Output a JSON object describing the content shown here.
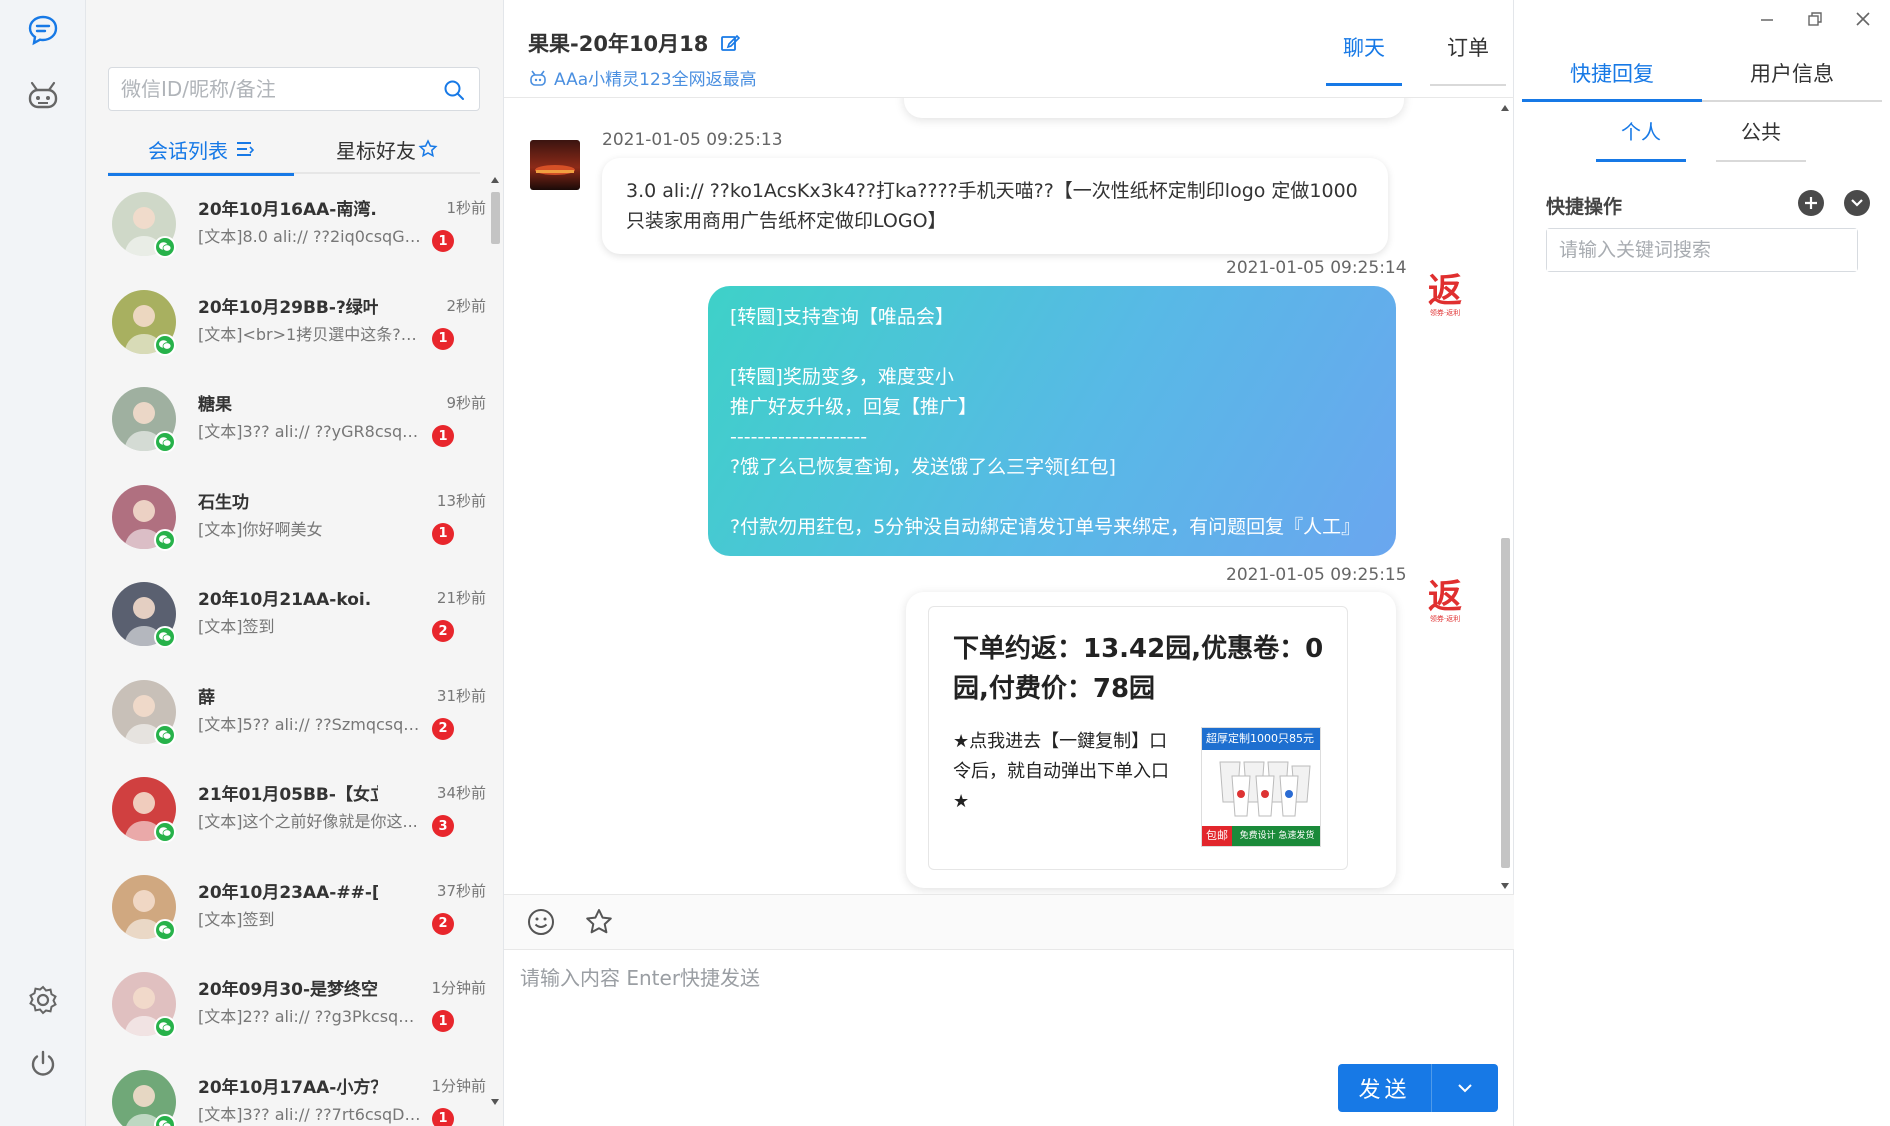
{
  "nav": {
    "icons": [
      "chat-icon",
      "robot-icon",
      "settings-icon",
      "power-icon"
    ]
  },
  "search": {
    "placeholder": "微信ID/昵称/备注"
  },
  "list_tabs": {
    "sessions": "会话列表",
    "starred": "星标好友"
  },
  "conversations": [
    {
      "name": "20年10月16AA-南湾...",
      "time": "1秒前",
      "msg": "[文本]8.0 ali:// ??2iq0csqGW...",
      "unread": "1",
      "avatar_color": "#cfd8c8"
    },
    {
      "name": "20年10月29BB-?绿叶...",
      "time": "2秒前",
      "msg": "[文本]<br>1拷贝選中这条??...",
      "unread": "1",
      "avatar_color": "#a8b060"
    },
    {
      "name": "糖果",
      "time": "9秒前",
      "msg": "[文本]3?? ali:// ??yGR8csqDT...",
      "unread": "1",
      "avatar_color": "#9fb0a0"
    },
    {
      "name": "石生功",
      "time": "13秒前",
      "msg": "[文本]你好啊美女",
      "unread": "1",
      "avatar_color": "#b07080"
    },
    {
      "name": "20年10月21AA-koi.",
      "time": "21秒前",
      "msg": "[文本]签到",
      "unread": "2",
      "avatar_color": "#5a6070"
    },
    {
      "name": "薛",
      "time": "31秒前",
      "msg": "[文本]5?? ali:// ??SzmqcsqD...",
      "unread": "2",
      "avatar_color": "#c8c0b8"
    },
    {
      "name": "21年01月05BB-【女立...",
      "time": "34秒前",
      "msg": "[文本]这个之前好像就是你这...",
      "unread": "3",
      "avatar_color": "#d04040"
    },
    {
      "name": "20年10月23AA-##-[A...",
      "time": "37秒前",
      "msg": "[文本]签到",
      "unread": "2",
      "avatar_color": "#d0a880"
    },
    {
      "name": "20年09月30-是梦终空≡°",
      "time": "1分钟前",
      "msg": "[文本]2?? ali:// ??g3PkcsqDh...",
      "unread": "1",
      "avatar_color": "#e0c0c0"
    },
    {
      "name": "20年10月17AA-小方？",
      "time": "1分钟前",
      "msg": "[文本]3?? ali:// ??7rt6csqDh...",
      "unread": "1",
      "avatar_color": "#70a878"
    }
  ],
  "chat": {
    "title": "果果-20年10月18",
    "subtitle": "AAa小精灵123全网返最高",
    "tabs": {
      "chat": "聊天",
      "order": "订单"
    },
    "messages": {
      "m1_time": "2021-01-05 09:25:13",
      "m1_text": "3.0 ali:// ??ko1AcsKx3k4??打ka????手机天喵??【一次性纸杯定制印logo 定做1000只装家用商用广告纸杯定做印LOGO】",
      "m2_time": "2021-01-05 09:25:14",
      "m2_text": "[转圜]支持查询【唯品会】\n\n[转圜]奖励变多，难度变小\n推广好友升级，回复【推广】\n--------------------\n?饿了么已恢复查询，发送饿了么三字领[红包]\n\n?付款勿用荭包，5分钟没自动綁定请发订单号来绑定，有问题回复『人工』",
      "m3_time": "2021-01-05 09:25:15",
      "m3_headline": "下单约返：13.42园,优惠卷：0园,付费价：78园",
      "m3_body": "★点我进去【一鍵复制】口令后，就自动弹出下单入口★",
      "m3_img_top": "超厚定制1000只85元",
      "m3_img_tag": "包邮",
      "m3_img_bottom": "免费设计 急速发货",
      "fan_logo": "返",
      "fan_logo_sub": "领券·返利"
    },
    "input_placeholder": "请输入内容 Enter快捷发送",
    "send_label": "发送"
  },
  "right": {
    "tabs": {
      "quick": "快捷回复",
      "userinfo": "用户信息"
    },
    "subtabs": {
      "personal": "个人",
      "public": "公共"
    },
    "quick_ops": "快捷操作",
    "search_placeholder": "请输入关键词搜索"
  }
}
